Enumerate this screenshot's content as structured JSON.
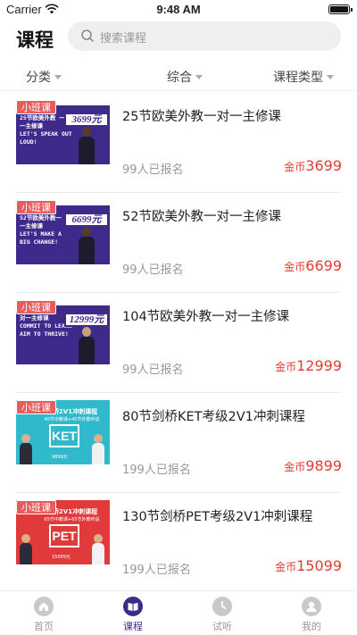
{
  "status_bar": {
    "carrier": "Carrier",
    "time": "9:48 AM"
  },
  "header": {
    "title": "课程",
    "search_placeholder": "搜索课程"
  },
  "filters": [
    {
      "label": "分类"
    },
    {
      "label": "综合"
    },
    {
      "label": "课程类型"
    }
  ],
  "colors": {
    "accent": "#3d2a8a",
    "price": "#e83a2e",
    "tag": "#e55d5d"
  },
  "courses": [
    {
      "tag": "小班课",
      "title": "25节欧美外教一对一主修课",
      "enrolled": "99人已报名",
      "price_unit": "金币",
      "price": "3699",
      "thumb": {
        "style": "purple",
        "headline_cn": "25节欧美外教 一对一主修课",
        "headline_en": "LET'S SPEAK OUT LOUD!",
        "price_tag": "3699元"
      }
    },
    {
      "tag": "小班课",
      "title": "52节欧美外教一对一主修课",
      "enrolled": "99人已报名",
      "price_unit": "金币",
      "price": "6699",
      "thumb": {
        "style": "purple",
        "headline_cn": "52节欧美外教一 对一主修课",
        "headline_en": "LET'S MAKE A BIG CHANGE!",
        "price_tag": "6699元"
      }
    },
    {
      "tag": "小班课",
      "title": "104节欧美外教一对一主修课",
      "enrolled": "99人已报名",
      "price_unit": "金币",
      "price": "12999",
      "thumb": {
        "style": "purple",
        "headline_cn": "对一主修课",
        "headline_en": "COMMIT TO LEARN AIM TO THRIVE!",
        "price_tag": "12999元"
      }
    },
    {
      "tag": "小班课",
      "title": "80节剑桥KET考级2V1冲刺课程",
      "enrolled": "199人已报名",
      "price_unit": "金币",
      "price": "9899",
      "thumb": {
        "style": "teal",
        "exam_title": "剑桥2V1冲刺课程",
        "exam_sub": "40节中教课+40节外教听说",
        "badge": "KET",
        "foot": "9899元"
      }
    },
    {
      "tag": "小班课",
      "title": "130节剑桥PET考级2V1冲刺课程",
      "enrolled": "199人已报名",
      "price_unit": "金币",
      "price": "15099",
      "thumb": {
        "style": "red",
        "exam_title": "剑桥2V1冲刺课程",
        "exam_sub": "65节中教课+65节外教听说",
        "badge": "PET",
        "foot": "15099元"
      }
    }
  ],
  "tabbar": [
    {
      "label": "首页",
      "icon": "home-icon",
      "active": false
    },
    {
      "label": "课程",
      "icon": "book-icon",
      "active": true
    },
    {
      "label": "试听",
      "icon": "clock-icon",
      "active": false
    },
    {
      "label": "我的",
      "icon": "profile-icon",
      "active": false
    }
  ]
}
